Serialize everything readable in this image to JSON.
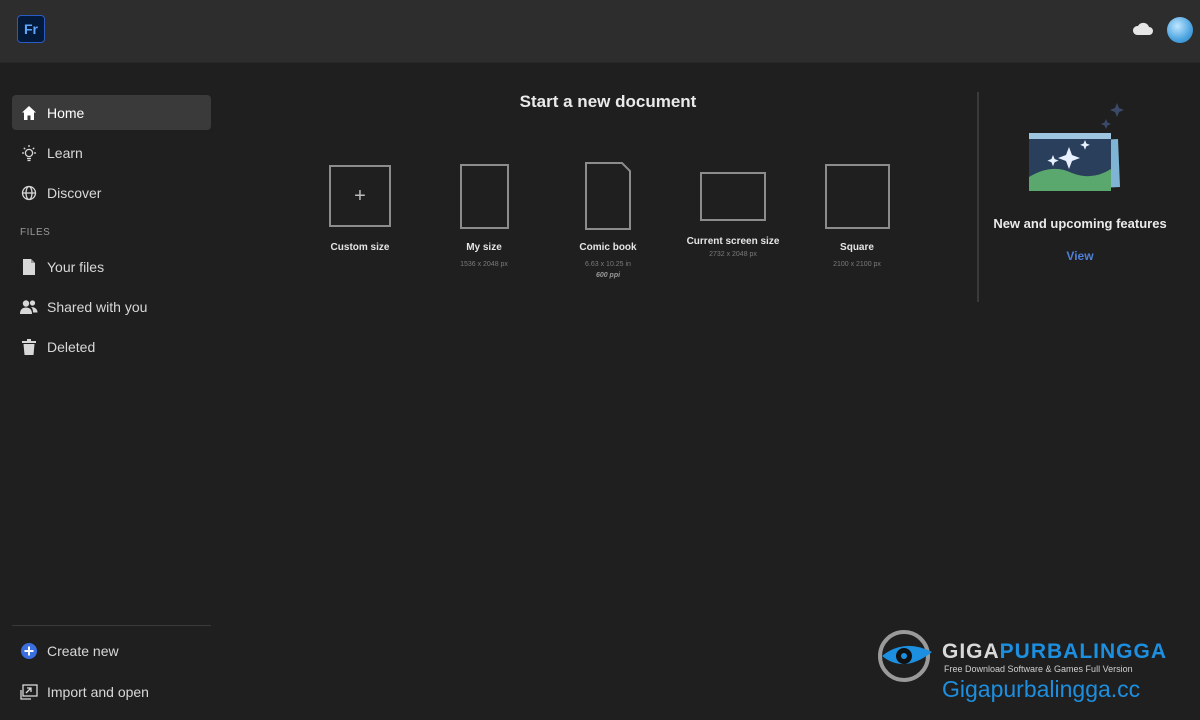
{
  "app": {
    "logo_text": "Fr"
  },
  "topbar": {
    "cloud_icon": "cloud-icon",
    "avatar_icon": "avatar"
  },
  "sidebar": {
    "items": [
      {
        "label": "Home",
        "icon": "home-icon",
        "active": true
      },
      {
        "label": "Learn",
        "icon": "lightbulb-icon"
      },
      {
        "label": "Discover",
        "icon": "globe-icon"
      }
    ],
    "section_label": "FILES",
    "file_items": [
      {
        "label": "Your files",
        "icon": "document-icon"
      },
      {
        "label": "Shared with you",
        "icon": "people-icon"
      },
      {
        "label": "Deleted",
        "icon": "trash-icon"
      }
    ],
    "bottom_items": [
      {
        "label": "Create new",
        "icon": "plus-circle-icon"
      },
      {
        "label": "Import and open",
        "icon": "import-icon"
      }
    ]
  },
  "main": {
    "title": "Start a new document",
    "presets": [
      {
        "name": "Custom size",
        "dims": "",
        "dims_extra": ""
      },
      {
        "name": "My size",
        "dims": "1536 x 2048 px",
        "dims_extra": ""
      },
      {
        "name": "Comic book",
        "dims": "6.63 x 10.25 in",
        "dims_extra": "600 ppi"
      },
      {
        "name": "Current screen size",
        "dims": "2732 x 2048 px",
        "dims_extra": ""
      },
      {
        "name": "Square",
        "dims": "2100 x 2100 px",
        "dims_extra": ""
      }
    ]
  },
  "features": {
    "title": "New and upcoming features",
    "link": "View"
  },
  "watermark": {
    "brand_part1": "GIGA",
    "brand_part2": "PURBALINGGA",
    "subtitle": "Free Download Software & Games Full Version",
    "url": "Gigapurbalingga.cc"
  },
  "colors": {
    "accent": "#4f7fd6",
    "background": "#1f1f1f",
    "topbar": "#2d2d2d",
    "active_item": "#3a3a3a"
  }
}
